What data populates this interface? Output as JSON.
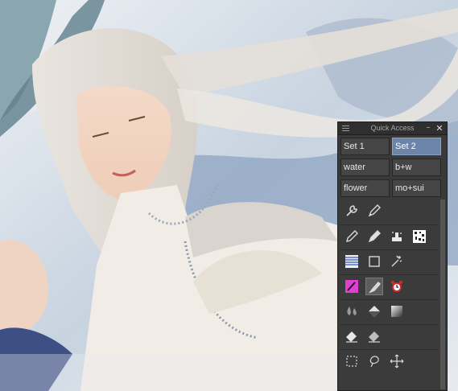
{
  "panel": {
    "title": "Quick Access",
    "minimize_glyph": "–",
    "close_glyph": "✕"
  },
  "sets": [
    {
      "label": "Set 1",
      "selected": false
    },
    {
      "label": "Set 2",
      "selected": true
    },
    {
      "label": "water",
      "selected": false
    },
    {
      "label": "b+w",
      "selected": false
    },
    {
      "label": "flower",
      "selected": false
    },
    {
      "label": "mo+sui",
      "selected": false
    }
  ],
  "tool_rows": [
    [
      "wrench-icon",
      "pen-icon"
    ],
    [
      "pencil-icon",
      "pen-icon",
      "stamp-icon",
      "pattern-icon"
    ],
    [
      "lines-icon",
      "rectangle-icon",
      "sparkle-icon"
    ],
    [
      "magenta-brush-icon",
      "brush-icon",
      "alarm-clock-icon"
    ],
    [
      "water-drops-icon",
      "fill-bucket-icon",
      "gradient-icon"
    ],
    [
      "eraser-icon",
      "eraser-soft-icon"
    ],
    [
      "rect-select-icon",
      "lasso-icon",
      "move-icon"
    ]
  ],
  "colors": {
    "panel_bg": "#3a3a3a",
    "selected_set": "#6c84a8",
    "magenta_brush": "#e040d0",
    "alarm_red": "#d8282a"
  }
}
